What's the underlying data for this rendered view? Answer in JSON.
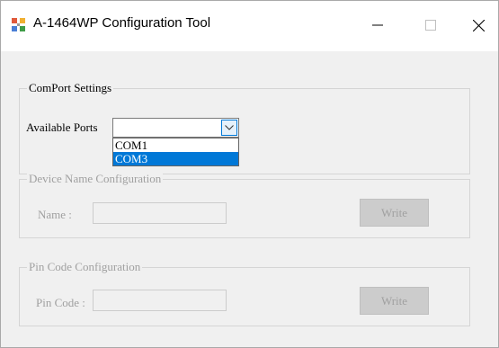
{
  "window": {
    "title": "A-1464WP Configuration Tool",
    "icon": "app-window-icon",
    "controls": {
      "minimize": "minimize-icon",
      "maximize": "maximize-icon",
      "close": "close-icon"
    }
  },
  "comport": {
    "group_label": "ComPort Settings",
    "ports_label": "Available Ports",
    "selected_value": "",
    "options": [
      "COM1",
      "COM3"
    ],
    "highlighted_option": "COM3"
  },
  "device_name": {
    "group_label": "Device Name Configuration",
    "name_label": "Name :",
    "name_value": "",
    "write_label": "Write"
  },
  "pin_code": {
    "group_label": "Pin Code Configuration",
    "pin_label": "Pin Code :",
    "pin_value": "",
    "write_label": "Write"
  },
  "colors": {
    "selection": "#0078d7",
    "disabled_text": "#a0a0a0",
    "background": "#f0f0f0"
  }
}
